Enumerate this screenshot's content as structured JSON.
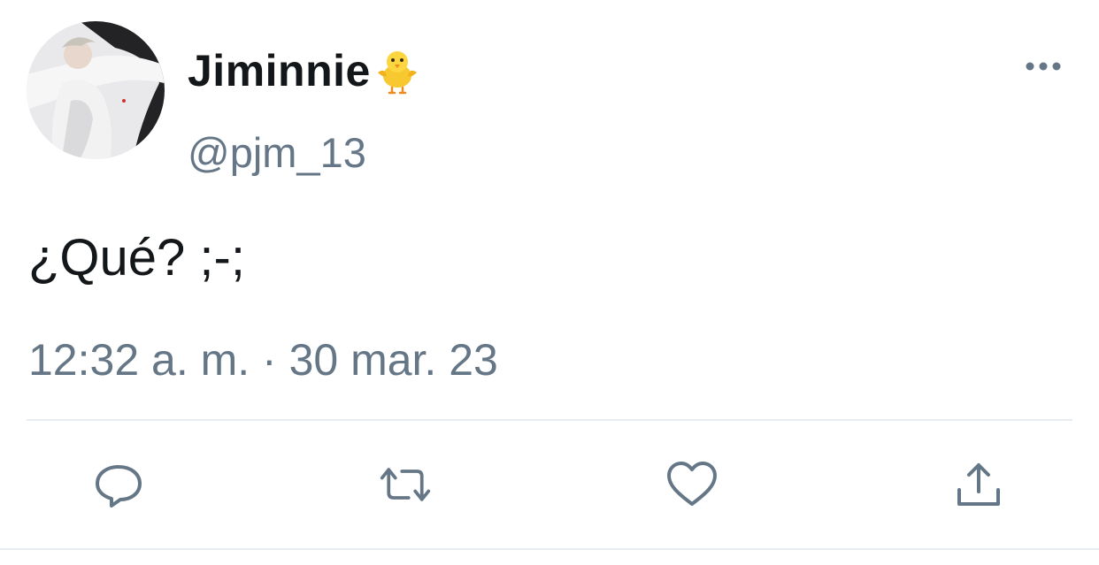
{
  "user": {
    "display_name": "Jiminnie",
    "name_emoji": "chick-icon",
    "handle": "@pjm_13",
    "avatar": "avatar-photo"
  },
  "tweet": {
    "text": "¿Qué? ;-;",
    "timestamp": "12:32 a. m. · 30 mar. 23"
  },
  "actions": [
    {
      "name": "reply",
      "icon": "reply-icon"
    },
    {
      "name": "retweet",
      "icon": "retweet-icon"
    },
    {
      "name": "like",
      "icon": "heart-icon"
    },
    {
      "name": "share",
      "icon": "share-icon"
    }
  ],
  "colors": {
    "text_primary": "#14171a",
    "text_secondary": "#657786",
    "divider": "#e6ecf0"
  }
}
